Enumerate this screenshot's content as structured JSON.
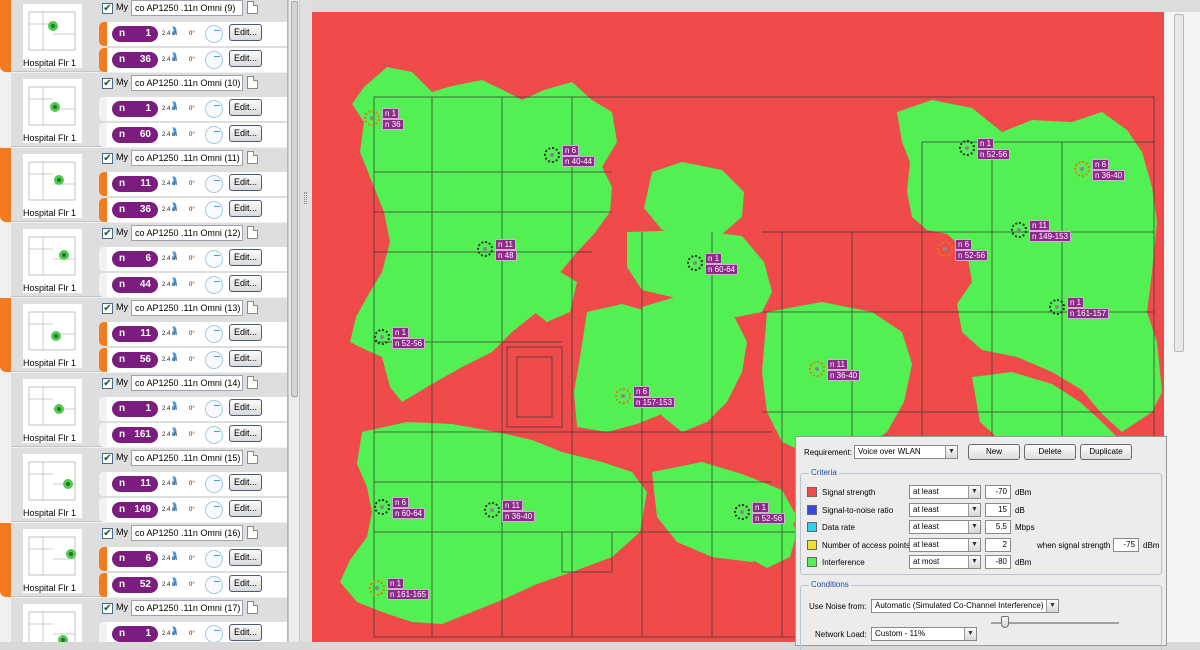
{
  "ap_list": {
    "cards": [
      {
        "accent": "orange",
        "thumb_label": "Hospital Flr 1",
        "checked": true,
        "my_label": "My",
        "name": "co AP1250 .11n Omni (9)",
        "radios": [
          {
            "accent": "orange",
            "band": "n",
            "channel": "1",
            "antenna": "2.4 m",
            "angle": "0°",
            "edit_label": "Edit..."
          },
          {
            "accent": "orange",
            "band": "n",
            "channel": "36",
            "antenna": "2.4 m",
            "angle": "0°",
            "edit_label": "Edit..."
          }
        ]
      },
      {
        "accent": "none",
        "thumb_label": "Hospital Flr 1",
        "checked": true,
        "my_label": "My",
        "name": "co AP1250 .11n Omni (10)",
        "radios": [
          {
            "accent": "none",
            "band": "n",
            "channel": "1",
            "antenna": "2.4 m",
            "angle": "0°",
            "edit_label": "Edit..."
          },
          {
            "accent": "none",
            "band": "n",
            "channel": "60",
            "antenna": "2.4 m",
            "angle": "0°",
            "edit_label": "Edit..."
          }
        ]
      },
      {
        "accent": "orange",
        "thumb_label": "Hospital Flr 1",
        "checked": true,
        "my_label": "My",
        "name": "co AP1250 .11n Omni (11)",
        "radios": [
          {
            "accent": "orange",
            "band": "n",
            "channel": "11",
            "antenna": "2.4 m",
            "angle": "0°",
            "edit_label": "Edit..."
          },
          {
            "accent": "orange",
            "band": "n",
            "channel": "36",
            "antenna": "2.4 m",
            "angle": "0°",
            "edit_label": "Edit..."
          }
        ]
      },
      {
        "accent": "none",
        "thumb_label": "Hospital Flr 1",
        "checked": true,
        "my_label": "My",
        "name": "co AP1250 .11n Omni (12)",
        "radios": [
          {
            "accent": "none",
            "band": "n",
            "channel": "6",
            "antenna": "2.4 m",
            "angle": "0°",
            "edit_label": "Edit..."
          },
          {
            "accent": "none",
            "band": "n",
            "channel": "44",
            "antenna": "2.4 m",
            "angle": "0°",
            "edit_label": "Edit..."
          }
        ]
      },
      {
        "accent": "orange",
        "thumb_label": "Hospital Flr 1",
        "checked": true,
        "my_label": "My",
        "name": "co AP1250 .11n Omni (13)",
        "radios": [
          {
            "accent": "orange",
            "band": "n",
            "channel": "11",
            "antenna": "2.4 m",
            "angle": "0°",
            "edit_label": "Edit..."
          },
          {
            "accent": "orange",
            "band": "n",
            "channel": "56",
            "antenna": "2.4 m",
            "angle": "0°",
            "edit_label": "Edit..."
          }
        ]
      },
      {
        "accent": "none",
        "thumb_label": "Hospital Flr 1",
        "checked": true,
        "my_label": "My",
        "name": "co AP1250 .11n Omni (14)",
        "radios": [
          {
            "accent": "none",
            "band": "n",
            "channel": "1",
            "antenna": "2.4 m",
            "angle": "0°",
            "edit_label": "Edit..."
          },
          {
            "accent": "none",
            "band": "n",
            "channel": "161",
            "antenna": "2.4 m",
            "angle": "0°",
            "edit_label": "Edit..."
          }
        ]
      },
      {
        "accent": "none",
        "thumb_label": "Hospital Flr 1",
        "checked": true,
        "my_label": "My",
        "name": "co AP1250 .11n Omni (15)",
        "radios": [
          {
            "accent": "none",
            "band": "n",
            "channel": "11",
            "antenna": "2.4 m",
            "angle": "0°",
            "edit_label": "Edit..."
          },
          {
            "accent": "none",
            "band": "n",
            "channel": "149",
            "antenna": "2.4 m",
            "angle": "0°",
            "edit_label": "Edit..."
          }
        ]
      },
      {
        "accent": "orange",
        "thumb_label": "Hospital Flr 1",
        "checked": true,
        "my_label": "My",
        "name": "co AP1250 .11n Omni (16)",
        "radios": [
          {
            "accent": "orange",
            "band": "n",
            "channel": "6",
            "antenna": "2.4 m",
            "angle": "0°",
            "edit_label": "Edit..."
          },
          {
            "accent": "orange",
            "band": "n",
            "channel": "52",
            "antenna": "2.4 m",
            "angle": "0°",
            "edit_label": "Edit..."
          }
        ]
      },
      {
        "accent": "none",
        "thumb_label": "Hospital Flr 1",
        "checked": true,
        "my_label": "My",
        "name": "co AP1250 .11n Omni (17)",
        "radios": [
          {
            "accent": "none",
            "band": "n",
            "channel": "1",
            "antenna": "2.4 m",
            "angle": "0°",
            "edit_label": "Edit..."
          }
        ]
      }
    ]
  },
  "heatmap": {
    "colors": {
      "fail": "#f04a4a",
      "pass": "#52f052",
      "floorplan": "#3a3a3a",
      "label_bg": "#8e2a8a"
    },
    "ap_labels": [
      {
        "lines": [
          "n 1",
          "n 36"
        ],
        "marker": "hot"
      },
      {
        "lines": [
          "n 6",
          "n 40-44"
        ],
        "marker": "dark"
      },
      {
        "lines": [
          "n 11",
          "n 48"
        ],
        "marker": "dark"
      },
      {
        "lines": [
          "n 1",
          "n 60-64"
        ],
        "marker": "dark"
      },
      {
        "lines": [
          "n 1",
          "n 52-56"
        ],
        "marker": "dark"
      },
      {
        "lines": [
          "n 6",
          "n 36-40"
        ],
        "marker": "hot"
      },
      {
        "lines": [
          "n 11",
          "n 149-153"
        ],
        "marker": "dark"
      },
      {
        "lines": [
          "n 6",
          "n 52-56"
        ],
        "marker": "hot"
      },
      {
        "lines": [
          "n 1",
          "n 161-157"
        ],
        "marker": "dark"
      },
      {
        "lines": [
          "n 1",
          "n 52-56"
        ],
        "marker": "dark"
      },
      {
        "lines": [
          "n 11",
          "n 36-40"
        ],
        "marker": "hot"
      },
      {
        "lines": [
          "n 6",
          "n 157-153"
        ],
        "marker": "hot"
      },
      {
        "lines": [
          "n 6",
          "n 60-64"
        ],
        "marker": "dark"
      },
      {
        "lines": [
          "n 11",
          "n 36-40"
        ],
        "marker": "dark"
      },
      {
        "lines": [
          "n 1",
          "n 52-56"
        ],
        "marker": "dark"
      },
      {
        "lines": [
          "n 1",
          "n 161-165"
        ],
        "marker": "hot"
      }
    ]
  },
  "requirements": {
    "requirement_label": "Requirement:",
    "requirement_value": "Voice over WLAN",
    "new_label": "New",
    "delete_label": "Delete",
    "duplicate_label": "Duplicate",
    "criteria_title": "Criteria",
    "criteria": [
      {
        "color": "#f04a4a",
        "label": "Signal strength",
        "op": "at least",
        "value": "-70",
        "unit": "dBm"
      },
      {
        "color": "#3a4ae0",
        "label": "Signal-to-noise ratio",
        "op": "at least",
        "value": "15",
        "unit": "dB"
      },
      {
        "color": "#30d0e8",
        "label": "Data rate",
        "op": "at least",
        "value": "5.5",
        "unit": "Mbps"
      },
      {
        "color": "#f0e030",
        "label": "Number of access points",
        "op": "at least",
        "value": "2",
        "unit": ""
      },
      {
        "color": "#52f052",
        "label": "Interference",
        "op": "at most",
        "value": "-80",
        "unit": "dBm"
      }
    ],
    "when_signal_label": "when signal strength",
    "when_signal_value": "-75",
    "when_signal_unit": "dBm",
    "conditions_title": "Conditions",
    "noise_label": "Use Noise from:",
    "noise_value": "Automatic (Simulated Co-Channel Interference)",
    "load_label": "Network Load:",
    "load_value": "Custom - 11%",
    "load_level_percent": 11
  }
}
